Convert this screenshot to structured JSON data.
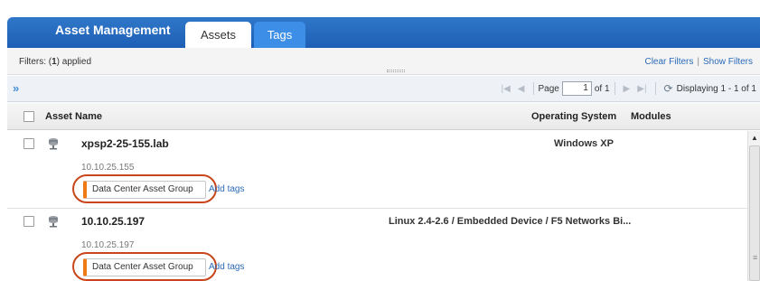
{
  "header": {
    "title": "Asset Management",
    "tabs": [
      {
        "label": "Assets",
        "active": true
      },
      {
        "label": "Tags",
        "active": false
      }
    ]
  },
  "filters": {
    "prefix": "Filters: (",
    "count": "1",
    "suffix": ") applied",
    "clear_label": "Clear Filters",
    "separator": "|",
    "show_label": "Show Filters"
  },
  "pager": {
    "expand_icon": "»",
    "page_label": "Page",
    "page_value": "1",
    "of_label": "of 1",
    "display_text": "Displaying 1 - 1 of 1"
  },
  "columns": {
    "name": "Asset Name",
    "os": "Operating System",
    "modules": "Modules"
  },
  "rows": [
    {
      "name": "xpsp2-25-155.lab",
      "os": "Windows XP",
      "ip": "10.10.25.155",
      "tag": "Data Center Asset Group",
      "add_tags": "Add tags"
    },
    {
      "name": "10.10.25.197",
      "os": "Linux 2.4-2.6 / Embedded Device / F5 Networks Bi...",
      "ip": "10.10.25.197",
      "tag": "Data Center Asset Group",
      "add_tags": "Add tags"
    }
  ],
  "colors": {
    "header_blue": "#1e5fb5",
    "tag_accent": "#f07a16",
    "highlight_ring": "#c8461b",
    "link": "#2a6ab8"
  },
  "icons": {
    "expand": "double-chevron-right-icon",
    "first_page": "first-page-icon",
    "prev_page": "prev-page-icon",
    "next_page": "next-page-icon",
    "last_page": "last-page-icon",
    "refresh": "refresh-icon",
    "asset": "server-icon"
  }
}
